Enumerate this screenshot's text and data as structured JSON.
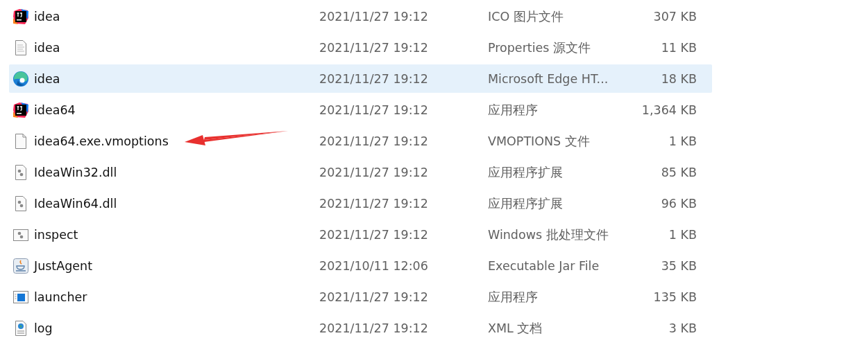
{
  "files": [
    {
      "name": "idea",
      "kind": "jetbrains",
      "modified": "2021/11/27 19:12",
      "type": "ICO 图片文件",
      "size": "307 KB",
      "selected": false
    },
    {
      "name": "idea",
      "kind": "text",
      "modified": "2021/11/27 19:12",
      "type": "Properties 源文件",
      "size": "11 KB",
      "selected": false
    },
    {
      "name": "idea",
      "kind": "edge",
      "modified": "2021/11/27 19:12",
      "type": "Microsoft Edge HT...",
      "size": "18 KB",
      "selected": true
    },
    {
      "name": "idea64",
      "kind": "jetbrains",
      "modified": "2021/11/27 19:12",
      "type": "应用程序",
      "size": "1,364 KB",
      "selected": false
    },
    {
      "name": "idea64.exe.vmoptions",
      "kind": "blank",
      "modified": "2021/11/27 19:12",
      "type": "VMOPTIONS 文件",
      "size": "1 KB",
      "selected": false
    },
    {
      "name": "IdeaWin32.dll",
      "kind": "dll",
      "modified": "2021/11/27 19:12",
      "type": "应用程序扩展",
      "size": "85 KB",
      "selected": false
    },
    {
      "name": "IdeaWin64.dll",
      "kind": "dll",
      "modified": "2021/11/27 19:12",
      "type": "应用程序扩展",
      "size": "96 KB",
      "selected": false
    },
    {
      "name": "inspect",
      "kind": "batch",
      "modified": "2021/11/27 19:12",
      "type": "Windows 批处理文件",
      "size": "1 KB",
      "selected": false
    },
    {
      "name": "JustAgent",
      "kind": "jar",
      "modified": "2021/10/11 12:06",
      "type": "Executable Jar File",
      "size": "35 KB",
      "selected": false
    },
    {
      "name": "launcher",
      "kind": "exe",
      "modified": "2021/11/27 19:12",
      "type": "应用程序",
      "size": "135 KB",
      "selected": false
    },
    {
      "name": "log",
      "kind": "xml",
      "modified": "2021/11/27 19:12",
      "type": "XML 文档",
      "size": "3 KB",
      "selected": false
    }
  ],
  "annotation": {
    "kind": "arrow"
  }
}
